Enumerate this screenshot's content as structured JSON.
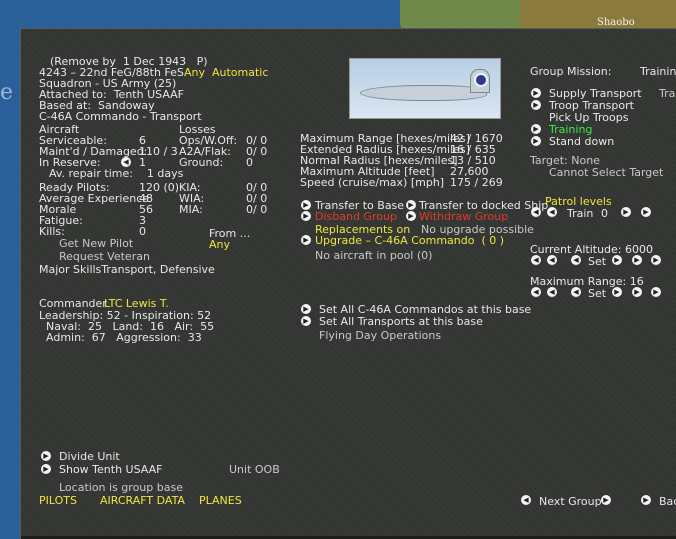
{
  "map": {
    "label": "Shaobo"
  },
  "unit": {
    "remove_note": "(Remove by  1 Dec 1943   P)",
    "id_name": "4243 – 22nd FeG/88th FeS",
    "mode": "Any  Automatic",
    "squadron": "Squadron - US Army (25)",
    "attached": "Attached to:  Tenth USAAF",
    "based": "Based at:  Sandoway",
    "aircraft_type": "C-46A Commando - Transport"
  },
  "aircraft_stats": {
    "aircraft_header": "Aircraft",
    "losses_header": "Losses",
    "rows": [
      {
        "label": "Serviceable:",
        "value": "6",
        "loss_label": "Ops/W.Off:",
        "loss_value": "0/ 0"
      },
      {
        "label": "Maint'd / Damaged:",
        "value": "110 / 3",
        "loss_label": "A2A/Flak:",
        "loss_value": "0/ 0"
      },
      {
        "label": "In Reserve:",
        "value": "1",
        "loss_label": "Ground:",
        "loss_value": "0"
      }
    ],
    "repair": "Av. repair time:    1 days"
  },
  "pilots": {
    "rows": [
      {
        "label": "Ready Pilots:",
        "value": "120 (0)",
        "kl": "KIA:",
        "kv": "0/ 0"
      },
      {
        "label": "Average Experience",
        "value": "48",
        "kl": "WIA:",
        "kv": "0/ 0"
      },
      {
        "label": "Morale",
        "value": "56",
        "kl": "MIA:",
        "kv": "0/ 0"
      },
      {
        "label": "Fatigue:",
        "value": "3"
      },
      {
        "label": "Kills:",
        "value": "0"
      }
    ],
    "from_label": "From ...",
    "from_value": "Any",
    "get_new": "Get New Pilot",
    "request_vet": "Request Veteran",
    "skills": "Major SkillsTransport, Defensive"
  },
  "commander": {
    "label": "Commander",
    "name": "LTC Lewis T.",
    "leadership": "Leadership: 52 - Inspiration: 52",
    "naval": "Naval:  25   Land:  16   Air:  55",
    "admin": "Admin:  67   Aggression:  33"
  },
  "performance": {
    "max_range_label": "Maximum Range [hexes/miles]",
    "max_range": "42 / 1670",
    "ext_radius_label": "Extended Radius [hexes/miles]",
    "ext_radius": "16 / 635",
    "norm_radius_label": "Normal Radius [hexes/miles]",
    "norm_radius": "13 / 510",
    "max_alt_label": "Maximum Altitude [feet]",
    "max_alt": "27,600",
    "speed_label": "Speed (cruise/max) [mph]",
    "speed": "175 / 269"
  },
  "actions": {
    "transfer_base": "Transfer to Base",
    "transfer_ship": "Transfer to docked Ship",
    "disband": "Disband Group",
    "withdraw": "Withdraw Group",
    "replacements": "Replacements on",
    "no_upgrade": "No upgrade possible",
    "upgrade": "Upgrade – C-46A Commando  ( 0 )",
    "no_pool": "No aircraft in pool (0)",
    "set_all_type": "Set All C-46A Commandos at this base",
    "set_all_transports": "Set All Transports at this base",
    "flying_day": "Flying Day Operations"
  },
  "mission": {
    "header": "Group Mission:",
    "current": "Training",
    "options": [
      {
        "label": "Supply Transport",
        "extra": "Tra"
      },
      {
        "label": "Troop Transport"
      },
      {
        "label": "Pick Up Troops"
      },
      {
        "label": "Training"
      },
      {
        "label": "Stand down"
      }
    ],
    "target": "Target: None",
    "cannot_target": "Cannot Select Target",
    "patrol": "Patrol levels",
    "train_label": "Train",
    "train_value": "0",
    "current_alt": "Current Altitude: 6000",
    "set_label": "Set",
    "max_range": "Maximum Range: 16"
  },
  "footer": {
    "divide": "Divide Unit",
    "show_hq": "Show Tenth USAAF",
    "unit_oob": "Unit OOB",
    "location": "Location is group base",
    "pilots_link": "PILOTS",
    "aircraft_data_link": "AIRCRAFT DATA",
    "planes_link": "PLANES",
    "next_group": "Next Group",
    "back": "Back"
  }
}
